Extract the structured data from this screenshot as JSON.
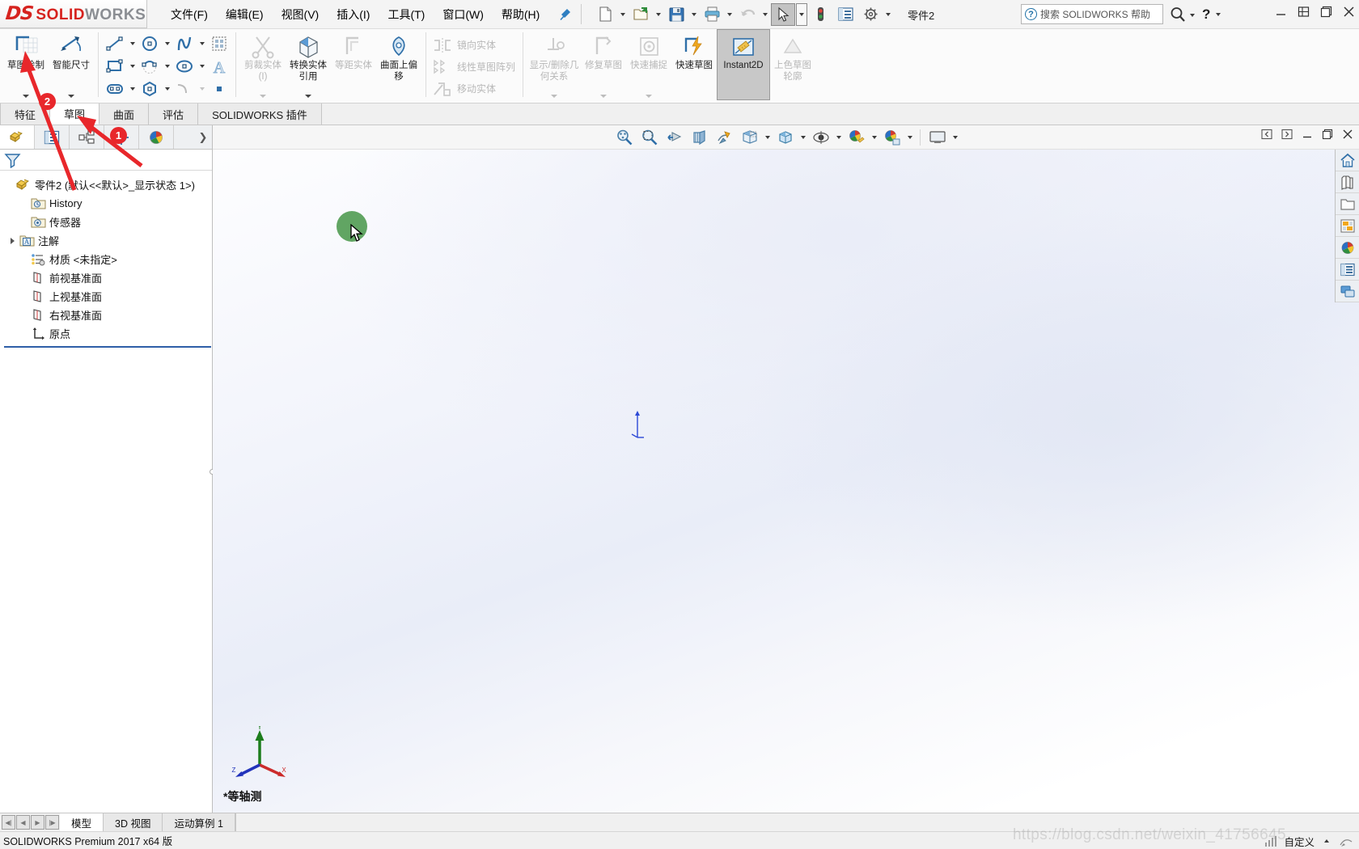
{
  "app": {
    "brand_ds": "DS",
    "brand_solid": "SOLID",
    "brand_works": "WORKS",
    "document_title": "零件2",
    "version_text": "SOLIDWORKS Premium 2017 x64 版"
  },
  "menu": {
    "items": [
      {
        "label": "文件(F)",
        "name": "menu-file"
      },
      {
        "label": "编辑(E)",
        "name": "menu-edit"
      },
      {
        "label": "视图(V)",
        "name": "menu-view"
      },
      {
        "label": "插入(I)",
        "name": "menu-insert"
      },
      {
        "label": "工具(T)",
        "name": "menu-tools"
      },
      {
        "label": "窗口(W)",
        "name": "menu-window"
      },
      {
        "label": "帮助(H)",
        "name": "menu-help"
      }
    ]
  },
  "search": {
    "placeholder": "搜索 SOLIDWORKS 帮助",
    "value": "搜索 SOLIDWORKS 帮助"
  },
  "quick_access": {
    "buttons": [
      {
        "name": "new-document-icon"
      },
      {
        "name": "open-document-icon"
      },
      {
        "name": "save-icon"
      },
      {
        "name": "print-icon"
      },
      {
        "name": "undo-icon"
      },
      {
        "name": "select-cursor-icon"
      },
      {
        "name": "rebuild-icon"
      },
      {
        "name": "options-list-icon"
      },
      {
        "name": "settings-gear-icon"
      }
    ]
  },
  "ribbon": {
    "groups": [
      {
        "name": "sketch-group",
        "big_buttons": [
          {
            "label": "草图绘制",
            "name": "sketch-button",
            "icon": "sketch-icon",
            "dropdown": true,
            "dim": false
          },
          {
            "label": "智能尺寸",
            "name": "smart-dimension-button",
            "icon": "smart-dimension-icon",
            "dropdown": true,
            "dim": false
          }
        ]
      },
      {
        "name": "entities-group",
        "small_buttons": [
          {
            "name": "line-icon",
            "dropdown": true
          },
          {
            "name": "circle-icon",
            "dropdown": true
          },
          {
            "name": "spline-icon",
            "dropdown": true
          },
          {
            "name": "pattern-icon",
            "dropdown": false
          },
          {
            "name": "rectangle-icon",
            "dropdown": true
          },
          {
            "name": "arc-icon",
            "dropdown": true
          },
          {
            "name": "ellipse-icon",
            "dropdown": true
          },
          {
            "name": "text-icon",
            "dropdown": false
          },
          {
            "name": "slot-icon",
            "dropdown": true
          },
          {
            "name": "polygon-icon",
            "dropdown": false
          },
          {
            "name": "fillet-icon",
            "dropdown": true
          },
          {
            "name": "point-icon",
            "dropdown": false
          }
        ]
      },
      {
        "name": "edit-group",
        "big_buttons": [
          {
            "label": "剪裁实体(I)",
            "name": "trim-entities-button",
            "icon": "trim-icon",
            "dropdown": true,
            "dim": true
          },
          {
            "label": "转换实体引用",
            "name": "convert-entities-button",
            "icon": "convert-entities-icon",
            "dropdown": true,
            "dim": false
          },
          {
            "label": "等距实体",
            "name": "offset-entities-button",
            "icon": "offset-icon",
            "dropdown": false,
            "dim": true
          },
          {
            "label": "曲面上偏移",
            "name": "offset-on-surface-button",
            "icon": "offset-surface-icon",
            "dropdown": false,
            "dim": false
          }
        ]
      },
      {
        "name": "modify-group",
        "wide_buttons": [
          {
            "label": "镜向实体",
            "name": "mirror-entities-button",
            "icon": "mirror-icon"
          },
          {
            "label": "线性草图阵列",
            "name": "linear-sketch-pattern-button",
            "icon": "linear-pattern-icon"
          },
          {
            "label": "移动实体",
            "name": "move-entities-button",
            "icon": "move-entities-icon"
          }
        ]
      },
      {
        "name": "relations-group",
        "big_buttons": [
          {
            "label": "显示/删除几何关系",
            "name": "display-delete-relations-button",
            "icon": "relations-icon",
            "dropdown": true,
            "dim": true
          },
          {
            "label": "修复草图",
            "name": "repair-sketch-button",
            "icon": "repair-sketch-icon",
            "dropdown": true,
            "dim": true
          },
          {
            "label": "快速捕捉",
            "name": "quick-snaps-button",
            "icon": "quick-snap-icon",
            "dropdown": true,
            "dim": true
          },
          {
            "label": "快速草图",
            "name": "rapid-sketch-button",
            "icon": "rapid-sketch-icon",
            "dropdown": false,
            "dim": false
          },
          {
            "label": "Instant2D",
            "name": "instant2d-button",
            "icon": "instant2d-icon",
            "dropdown": false,
            "dim": false,
            "selected": true
          },
          {
            "label": "上色草图轮廓",
            "name": "shaded-sketch-contours-button",
            "icon": "shaded-contour-icon",
            "dropdown": false,
            "dim": true
          }
        ]
      }
    ]
  },
  "command_tabs": {
    "items": [
      {
        "label": "特征",
        "name": "tab-features",
        "active": false
      },
      {
        "label": "草图",
        "name": "tab-sketch",
        "active": true
      },
      {
        "label": "曲面",
        "name": "tab-surfaces",
        "active": false
      },
      {
        "label": "评估",
        "name": "tab-evaluate",
        "active": false
      },
      {
        "label": "SOLIDWORKS 插件",
        "name": "tab-solidworks-addins",
        "active": false
      }
    ]
  },
  "feature_manager": {
    "tabs": [
      {
        "name": "feature-manager-tab",
        "icon": "feature-tree-icon",
        "active": true
      },
      {
        "name": "property-manager-tab",
        "icon": "property-manager-icon",
        "active": false
      },
      {
        "name": "configuration-manager-tab",
        "icon": "configuration-icon",
        "active": false
      },
      {
        "name": "dimxpert-manager-tab",
        "icon": "dimxpert-icon",
        "active": false
      },
      {
        "name": "display-manager-tab",
        "icon": "display-manager-icon",
        "active": false
      }
    ],
    "filter_placeholder": "",
    "tree": [
      {
        "label": "零件2  (默认<<默认>_显示状态 1>)",
        "icon": "part-icon",
        "indent": 0,
        "expandable": false,
        "name": "tree-item-part"
      },
      {
        "label": "History",
        "icon": "history-folder-icon",
        "indent": 1,
        "expandable": false,
        "name": "tree-item-history"
      },
      {
        "label": "传感器",
        "icon": "sensors-folder-icon",
        "indent": 1,
        "expandable": false,
        "name": "tree-item-sensors"
      },
      {
        "label": "注解",
        "icon": "annotations-folder-icon",
        "indent": 1,
        "expandable": true,
        "name": "tree-item-annotations"
      },
      {
        "label": "材质 <未指定>",
        "icon": "material-icon",
        "indent": 1,
        "expandable": false,
        "name": "tree-item-material"
      },
      {
        "label": "前视基准面",
        "icon": "plane-icon",
        "indent": 1,
        "expandable": false,
        "name": "tree-item-front-plane"
      },
      {
        "label": "上视基准面",
        "icon": "plane-icon",
        "indent": 1,
        "expandable": false,
        "name": "tree-item-top-plane"
      },
      {
        "label": "右视基准面",
        "icon": "plane-icon",
        "indent": 1,
        "expandable": false,
        "name": "tree-item-right-plane"
      },
      {
        "label": "原点",
        "icon": "origin-icon",
        "indent": 1,
        "expandable": false,
        "name": "tree-item-origin"
      }
    ]
  },
  "view_toolbar": {
    "buttons": [
      {
        "name": "zoom-to-fit-icon"
      },
      {
        "name": "zoom-to-area-icon"
      },
      {
        "name": "previous-view-icon"
      },
      {
        "name": "section-view-icon"
      },
      {
        "name": "view-orientation-icon"
      },
      {
        "name": "display-style-icon"
      },
      {
        "name": "hide-show-items-icon"
      },
      {
        "name": "edit-appearance-icon"
      },
      {
        "name": "apply-scene-icon"
      },
      {
        "name": "view-settings-icon"
      }
    ]
  },
  "task_pane": {
    "buttons": [
      {
        "name": "solidworks-resources-icon"
      },
      {
        "name": "design-library-icon"
      },
      {
        "name": "file-explorer-icon"
      },
      {
        "name": "view-palette-icon"
      },
      {
        "name": "appearances-scenes-icon"
      },
      {
        "name": "custom-properties-icon"
      },
      {
        "name": "solidworks-forum-icon"
      }
    ]
  },
  "graphics": {
    "view_label": "*等轴测",
    "triad_axes": {
      "x": "X",
      "y": "Y",
      "z": "Z"
    }
  },
  "document_tabs": {
    "nav": [
      "first",
      "prev",
      "next",
      "last"
    ],
    "items": [
      {
        "label": "模型",
        "name": "doc-tab-model",
        "active": true
      },
      {
        "label": "3D 视图",
        "name": "doc-tab-3dviews",
        "active": false
      },
      {
        "label": "运动算例 1",
        "name": "doc-tab-motion-study",
        "active": false
      }
    ]
  },
  "status_bar": {
    "left_text": "SOLIDWORKS Premium 2017 x64 版",
    "customize_label": "自定义"
  },
  "annotations": {
    "badges": [
      {
        "number": "1",
        "name": "annotation-badge-1"
      },
      {
        "number": "2",
        "name": "annotation-badge-2"
      }
    ],
    "arrow_color": "#e8272b"
  },
  "watermark": {
    "text": "https://blog.csdn.net/weixin_41756645"
  },
  "colors": {
    "accent_red": "#d6231f",
    "annotation_red": "#e8272b",
    "selection_blue": "#2f5fa8",
    "green_circle": "#61a563"
  }
}
